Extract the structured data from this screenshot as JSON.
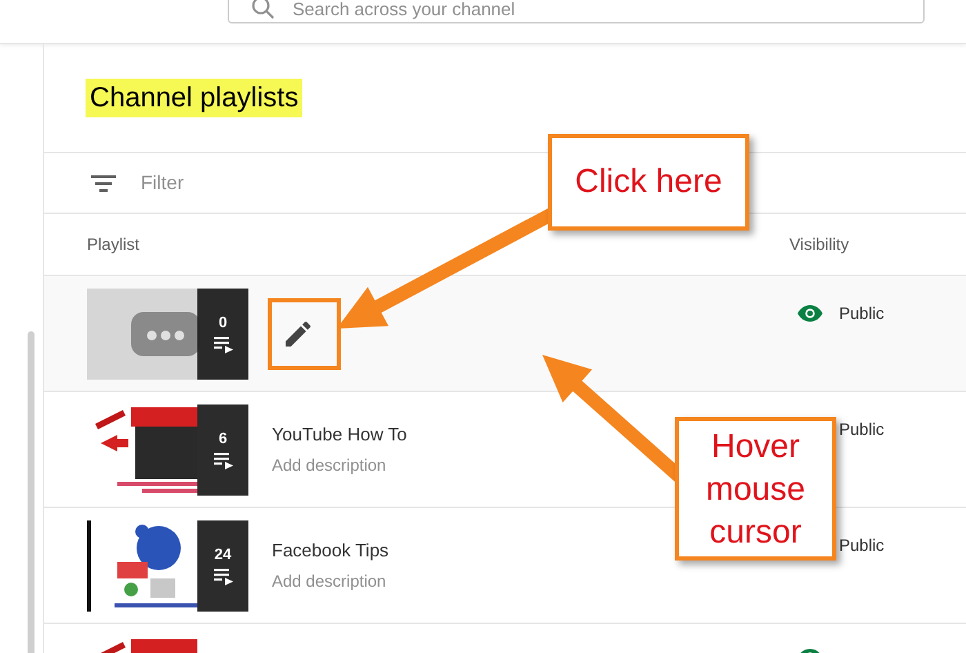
{
  "search": {
    "placeholder": "Search across your channel"
  },
  "title": "Channel playlists",
  "filter": {
    "placeholder": "Filter"
  },
  "columns": [
    "Playlist",
    "Visibility"
  ],
  "rows": [
    {
      "kind": "placeholder",
      "hovered": true,
      "count": "0",
      "visibility": "Public",
      "eye_shown": true
    },
    {
      "kind": "picture",
      "hovered": false,
      "title": "YouTube How To",
      "description": "Add description",
      "count": "6",
      "visibility": "Public",
      "eye_shown": false
    },
    {
      "kind": "picture",
      "hovered": false,
      "title": "Facebook Tips",
      "description": "Add description",
      "count": "24",
      "visibility": "Public",
      "eye_shown": false
    },
    {
      "kind": "picture",
      "hovered": false,
      "eye_shown": true
    }
  ],
  "annotations": [
    {
      "text": "Click here"
    },
    {
      "text": "Hover mouse cursor"
    }
  ]
}
